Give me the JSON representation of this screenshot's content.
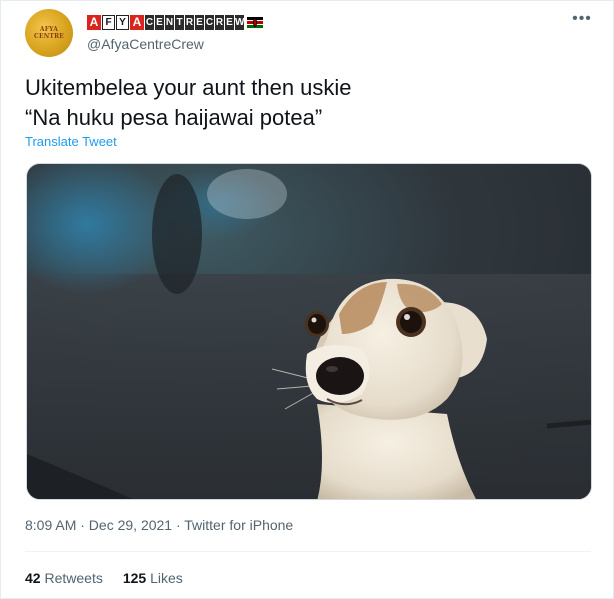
{
  "tweet": {
    "display_name_boxes": [
      {
        "char": "A",
        "style": "red"
      },
      {
        "char": "F",
        "style": "outline"
      },
      {
        "char": "Y",
        "style": "outline"
      },
      {
        "char": "A",
        "style": "red"
      },
      {
        "char": "C",
        "style": "dark"
      },
      {
        "char": "E",
        "style": "dark"
      },
      {
        "char": "N",
        "style": "dark"
      },
      {
        "char": "T",
        "style": "dark"
      },
      {
        "char": "R",
        "style": "dark"
      },
      {
        "char": "E",
        "style": "dark"
      },
      {
        "char": "C",
        "style": "dark"
      },
      {
        "char": "R",
        "style": "dark"
      },
      {
        "char": "E",
        "style": "dark"
      },
      {
        "char": "W",
        "style": "dark"
      }
    ],
    "flag_icon": "kenya-flag-icon",
    "handle": "@AfyaCentreCrew",
    "more_icon": "more-options-icon",
    "more_glyph": "•••",
    "text": "Ukitembelea your aunt then uskie\n“Na huku pesa haijawai potea”",
    "translate_label": "Translate Tweet",
    "media_description_icon": "photo-media",
    "timestamp_line": "8:09 AM · Dec 29, 2021 · Twitter for iPhone",
    "retweets_count": "42",
    "retweets_label": "Retweets",
    "likes_count": "125",
    "likes_label": "Likes"
  },
  "colors": {
    "accent_link": "#1d9bf0",
    "secondary_text": "#536471",
    "primary_text": "#0f1419",
    "name_red": "#d9251d"
  }
}
